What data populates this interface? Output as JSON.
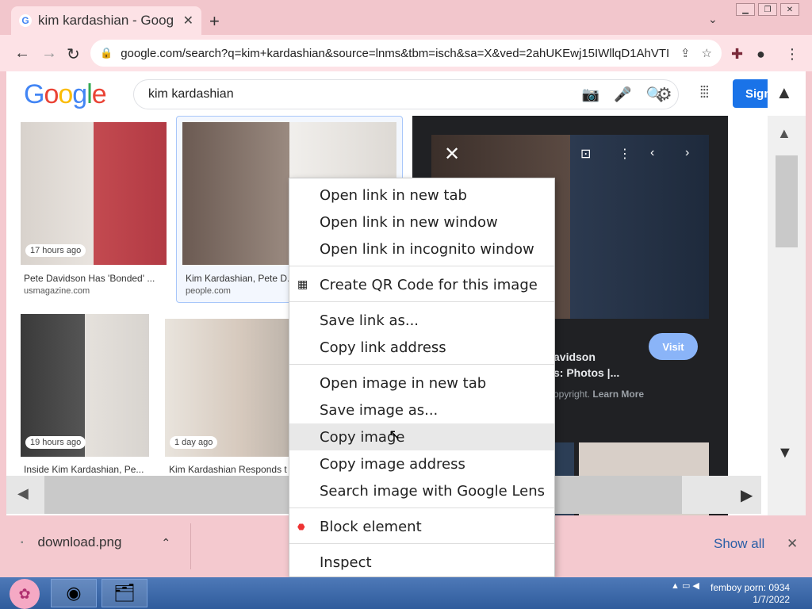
{
  "browser": {
    "tab_title": "kim kardashian - Goog",
    "url": "google.com/search?q=kim+kardashian&source=lnms&tbm=isch&sa=X&ved=2ahUKEwj15IWllqD1AhVTIYkE...",
    "win_buttons": [
      "minimize",
      "restore",
      "close"
    ]
  },
  "google": {
    "logo_letters": [
      "G",
      "o",
      "o",
      "g",
      "l",
      "e"
    ],
    "query": "kim kardashian",
    "sign_in": "Sign"
  },
  "results": [
    {
      "time": "17 hours ago",
      "caption": "Pete Davidson Has 'Bonded' ...",
      "source": "usmagazine.com"
    },
    {
      "time": "",
      "caption": "Kim Kardashian, Pete D...",
      "source": "people.com"
    },
    {
      "time": "19 hours ago",
      "caption": "Inside Kim Kardashian, Pe...",
      "source": ""
    },
    {
      "time": "1 day ago",
      "caption": "Kim Kardashian Responds t",
      "source": ""
    }
  ],
  "preview": {
    "title_line1": "avidson",
    "title_line2": "s: Photos |...",
    "copyright": "opyright.",
    "learn_more": "Learn More",
    "visit": "Visit"
  },
  "context_menu": {
    "items": [
      "Open link in new tab",
      "Open link in new window",
      "Open link in incognito window",
      "Create QR Code for this image",
      "Save link as...",
      "Copy link address",
      "Open image in new tab",
      "Save image as...",
      "Copy image",
      "Copy image address",
      "Search image with Google Lens",
      "Block element",
      "Inspect"
    ],
    "hovered": "Copy image"
  },
  "downloads": {
    "file": "download.png",
    "show_all": "Show all"
  },
  "taskbar": {
    "tray_text": "femboy porn: 0934",
    "date": "1/7/2022"
  }
}
